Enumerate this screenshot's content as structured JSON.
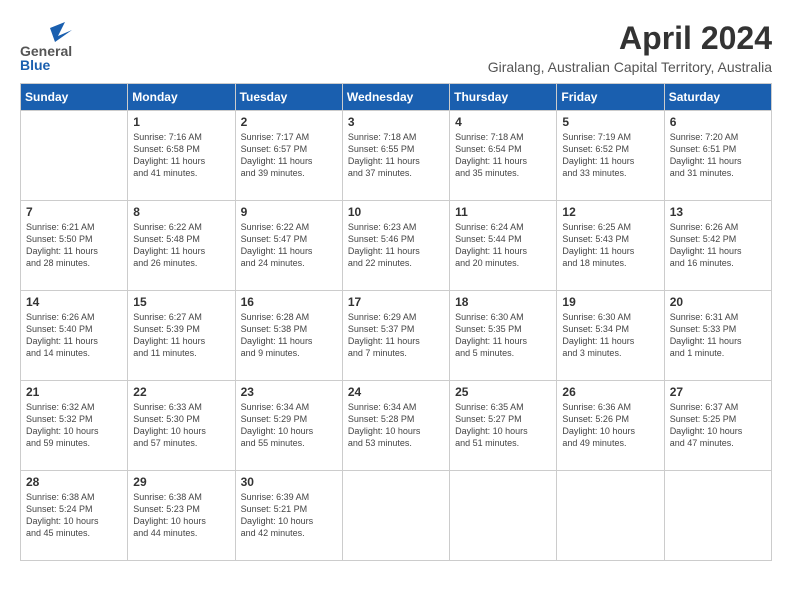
{
  "logo": {
    "line1": "General",
    "line2": "Blue"
  },
  "title": "April 2024",
  "location": "Giralang, Australian Capital Territory, Australia",
  "days_of_week": [
    "Sunday",
    "Monday",
    "Tuesday",
    "Wednesday",
    "Thursday",
    "Friday",
    "Saturday"
  ],
  "weeks": [
    [
      {
        "day": "",
        "info": ""
      },
      {
        "day": "1",
        "info": "Sunrise: 7:16 AM\nSunset: 6:58 PM\nDaylight: 11 hours\nand 41 minutes."
      },
      {
        "day": "2",
        "info": "Sunrise: 7:17 AM\nSunset: 6:57 PM\nDaylight: 11 hours\nand 39 minutes."
      },
      {
        "day": "3",
        "info": "Sunrise: 7:18 AM\nSunset: 6:55 PM\nDaylight: 11 hours\nand 37 minutes."
      },
      {
        "day": "4",
        "info": "Sunrise: 7:18 AM\nSunset: 6:54 PM\nDaylight: 11 hours\nand 35 minutes."
      },
      {
        "day": "5",
        "info": "Sunrise: 7:19 AM\nSunset: 6:52 PM\nDaylight: 11 hours\nand 33 minutes."
      },
      {
        "day": "6",
        "info": "Sunrise: 7:20 AM\nSunset: 6:51 PM\nDaylight: 11 hours\nand 31 minutes."
      }
    ],
    [
      {
        "day": "7",
        "info": "Sunrise: 6:21 AM\nSunset: 5:50 PM\nDaylight: 11 hours\nand 28 minutes."
      },
      {
        "day": "8",
        "info": "Sunrise: 6:22 AM\nSunset: 5:48 PM\nDaylight: 11 hours\nand 26 minutes."
      },
      {
        "day": "9",
        "info": "Sunrise: 6:22 AM\nSunset: 5:47 PM\nDaylight: 11 hours\nand 24 minutes."
      },
      {
        "day": "10",
        "info": "Sunrise: 6:23 AM\nSunset: 5:46 PM\nDaylight: 11 hours\nand 22 minutes."
      },
      {
        "day": "11",
        "info": "Sunrise: 6:24 AM\nSunset: 5:44 PM\nDaylight: 11 hours\nand 20 minutes."
      },
      {
        "day": "12",
        "info": "Sunrise: 6:25 AM\nSunset: 5:43 PM\nDaylight: 11 hours\nand 18 minutes."
      },
      {
        "day": "13",
        "info": "Sunrise: 6:26 AM\nSunset: 5:42 PM\nDaylight: 11 hours\nand 16 minutes."
      }
    ],
    [
      {
        "day": "14",
        "info": "Sunrise: 6:26 AM\nSunset: 5:40 PM\nDaylight: 11 hours\nand 14 minutes."
      },
      {
        "day": "15",
        "info": "Sunrise: 6:27 AM\nSunset: 5:39 PM\nDaylight: 11 hours\nand 11 minutes."
      },
      {
        "day": "16",
        "info": "Sunrise: 6:28 AM\nSunset: 5:38 PM\nDaylight: 11 hours\nand 9 minutes."
      },
      {
        "day": "17",
        "info": "Sunrise: 6:29 AM\nSunset: 5:37 PM\nDaylight: 11 hours\nand 7 minutes."
      },
      {
        "day": "18",
        "info": "Sunrise: 6:30 AM\nSunset: 5:35 PM\nDaylight: 11 hours\nand 5 minutes."
      },
      {
        "day": "19",
        "info": "Sunrise: 6:30 AM\nSunset: 5:34 PM\nDaylight: 11 hours\nand 3 minutes."
      },
      {
        "day": "20",
        "info": "Sunrise: 6:31 AM\nSunset: 5:33 PM\nDaylight: 11 hours\nand 1 minute."
      }
    ],
    [
      {
        "day": "21",
        "info": "Sunrise: 6:32 AM\nSunset: 5:32 PM\nDaylight: 10 hours\nand 59 minutes."
      },
      {
        "day": "22",
        "info": "Sunrise: 6:33 AM\nSunset: 5:30 PM\nDaylight: 10 hours\nand 57 minutes."
      },
      {
        "day": "23",
        "info": "Sunrise: 6:34 AM\nSunset: 5:29 PM\nDaylight: 10 hours\nand 55 minutes."
      },
      {
        "day": "24",
        "info": "Sunrise: 6:34 AM\nSunset: 5:28 PM\nDaylight: 10 hours\nand 53 minutes."
      },
      {
        "day": "25",
        "info": "Sunrise: 6:35 AM\nSunset: 5:27 PM\nDaylight: 10 hours\nand 51 minutes."
      },
      {
        "day": "26",
        "info": "Sunrise: 6:36 AM\nSunset: 5:26 PM\nDaylight: 10 hours\nand 49 minutes."
      },
      {
        "day": "27",
        "info": "Sunrise: 6:37 AM\nSunset: 5:25 PM\nDaylight: 10 hours\nand 47 minutes."
      }
    ],
    [
      {
        "day": "28",
        "info": "Sunrise: 6:38 AM\nSunset: 5:24 PM\nDaylight: 10 hours\nand 45 minutes."
      },
      {
        "day": "29",
        "info": "Sunrise: 6:38 AM\nSunset: 5:23 PM\nDaylight: 10 hours\nand 44 minutes."
      },
      {
        "day": "30",
        "info": "Sunrise: 6:39 AM\nSunset: 5:21 PM\nDaylight: 10 hours\nand 42 minutes."
      },
      {
        "day": "",
        "info": ""
      },
      {
        "day": "",
        "info": ""
      },
      {
        "day": "",
        "info": ""
      },
      {
        "day": "",
        "info": ""
      }
    ]
  ]
}
